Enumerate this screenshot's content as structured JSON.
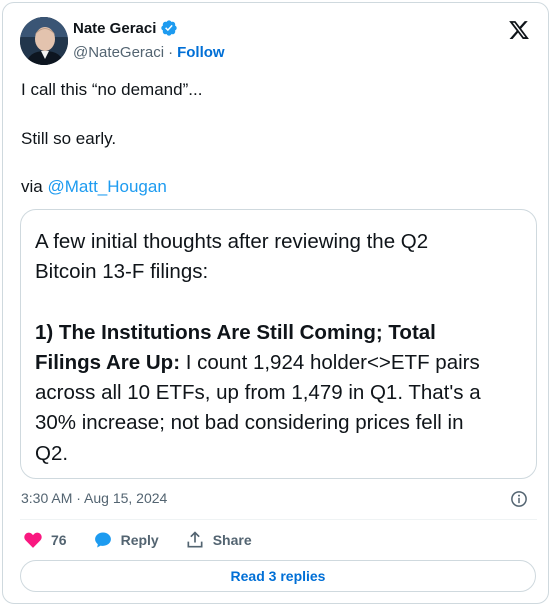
{
  "author": {
    "name": "Nate Geraci",
    "handle": "@NateGeraci",
    "separator": "·",
    "follow_label": "Follow"
  },
  "tweet": {
    "line1": "I call this “no demand”...",
    "line2": "Still so early.",
    "via_prefix": "via ",
    "via_mention": "@Matt_Hougan"
  },
  "quote": {
    "intro_line1": "A few initial thoughts after reviewing the Q2",
    "intro_line2": "Bitcoin 13-F filings:",
    "bold_line1": "1) The Institutions Are Still Coming; Total",
    "bold_line2": "Filings Are Up:",
    "rest_line2": " I count 1,924 holder<>ETF pairs",
    "line3": "across all 10 ETFs, up from 1,479 in Q1. That's a",
    "line4": "30% increase; not bad considering prices fell in",
    "line5": "Q2."
  },
  "meta": {
    "timestamp": "3:30 AM · Aug 15, 2024"
  },
  "actions": {
    "like_count": "76",
    "reply_label": "Reply",
    "share_label": "Share"
  },
  "footer": {
    "read_replies_label": "Read 3 replies"
  },
  "colors": {
    "link": "#1d9bf0",
    "follow": "#006fd6",
    "heart": "#f91880",
    "reply_icon": "#1d9bf0",
    "muted": "#536471"
  },
  "icons": [
    "verified-badge-icon",
    "x-logo-icon",
    "info-icon",
    "heart-icon",
    "reply-bubble-icon",
    "share-icon"
  ]
}
